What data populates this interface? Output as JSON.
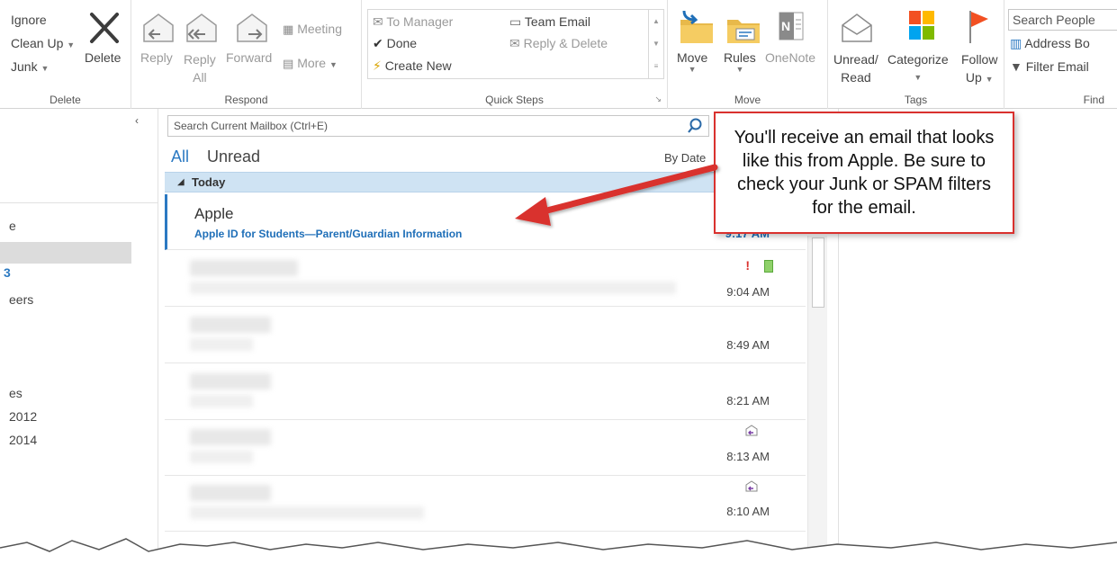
{
  "ribbon": {
    "delete_group": {
      "ignore": "Ignore",
      "clean_up": "Clean Up",
      "junk": "Junk",
      "delete": "Delete",
      "label": "Delete"
    },
    "respond_group": {
      "reply": "Reply",
      "reply_all_1": "Reply",
      "reply_all_2": "All",
      "forward": "Forward",
      "meeting": "Meeting",
      "more": "More",
      "label": "Respond"
    },
    "quick_steps_group": {
      "to_manager": "To Manager",
      "done": "Done",
      "create_new": "Create New",
      "team_email": "Team Email",
      "reply_delete": "Reply & Delete",
      "label": "Quick Steps"
    },
    "move_group": {
      "move": "Move",
      "rules": "Rules",
      "onenote": "OneNote",
      "label": "Move"
    },
    "tags_group": {
      "unread_read_1": "Unread/",
      "unread_read_2": "Read",
      "categorize": "Categorize",
      "follow_up_1": "Follow",
      "follow_up_2": "Up",
      "label": "Tags"
    },
    "find_group": {
      "search_people": "Search People",
      "address_book": "Address Bo",
      "filter_email": "Filter Email",
      "label": "Find"
    }
  },
  "folders": {
    "items": [
      "e",
      "3",
      "eers",
      "es",
      "2012",
      "2014"
    ]
  },
  "message_list": {
    "search_placeholder": "Search Current Mailbox (Ctrl+E)",
    "filter_all": "All",
    "filter_unread": "Unread",
    "sort": "By Date",
    "group_header": "Today",
    "messages": [
      {
        "sender": "Apple",
        "subject": "Apple ID for Students—Parent/Guardian Information",
        "time": "9:17 AM"
      },
      {
        "time": "9:04 AM"
      },
      {
        "time": "8:49 AM"
      },
      {
        "time": "8:21 AM"
      },
      {
        "time": "8:13 AM"
      },
      {
        "time": "8:10 AM"
      }
    ]
  },
  "callout": {
    "text": "You'll receive an email that looks like this from Apple. Be sure to check your Junk or SPAM filters for the email."
  },
  "colors": {
    "accent": "#2b79c2",
    "callout_border": "#d9312e",
    "flag": "#f25022",
    "categorize_1": "#f25022",
    "categorize_2": "#7fba00",
    "categorize_3": "#00a4ef",
    "categorize_4": "#ffb900"
  },
  "icons": [
    "close-x-icon",
    "reply-icon",
    "reply-all-icon",
    "forward-icon",
    "meeting-icon",
    "more-icon",
    "to-manager-icon",
    "done-check-icon",
    "create-new-icon",
    "team-email-icon",
    "reply-delete-icon",
    "move-folder-icon",
    "rules-icon",
    "onenote-icon",
    "unread-read-icon",
    "categorize-icon",
    "follow-up-flag-icon",
    "address-book-icon",
    "filter-icon",
    "search-icon",
    "importance-icon",
    "category-square-icon",
    "reply-arrow-icon"
  ]
}
